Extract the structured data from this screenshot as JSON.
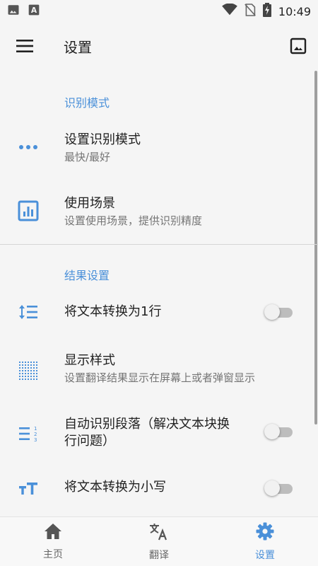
{
  "status_bar": {
    "time": "10:49",
    "icons": [
      "image-notification-icon",
      "text-notification-icon",
      "wifi-icon",
      "no-sim-icon",
      "battery-charging-icon"
    ]
  },
  "app_bar": {
    "title": "设置",
    "menu_icon": "hamburger-menu-icon",
    "action_icon": "image-icon"
  },
  "sections": [
    {
      "header": "识别模式",
      "items": [
        {
          "title": "设置识别模式",
          "summary": "最快/最好",
          "icon": "more-horiz-icon"
        },
        {
          "title": "使用场景",
          "summary": "设置使用场景，提供识别精度",
          "icon": "assessment-icon"
        }
      ]
    },
    {
      "header": "结果设置",
      "items": [
        {
          "title": "将文本转换为1行",
          "icon": "format-line-spacing-icon",
          "switch_on": false
        },
        {
          "title": "显示样式",
          "summary": "设置翻译结果显示在屏幕上或者弹窗显示",
          "icon": "dotted-grid-icon"
        },
        {
          "title": "自动识别段落（解决文本块换",
          "title_line2": "行问题）",
          "icon": "format-list-numbered-icon",
          "switch_on": false
        },
        {
          "title": "将文本转换为小写",
          "icon": "text-size-icon",
          "switch_on": false
        }
      ]
    }
  ],
  "bottom_nav": {
    "items": [
      {
        "label": "主页",
        "icon": "home-icon"
      },
      {
        "label": "翻译",
        "icon": "translate-icon"
      },
      {
        "label": "设置",
        "icon": "settings-icon",
        "active": true
      }
    ]
  },
  "colors": {
    "accent": "#4a90d9",
    "background": "#f5f5f5",
    "switch_track_off": "#bdbdbd"
  }
}
